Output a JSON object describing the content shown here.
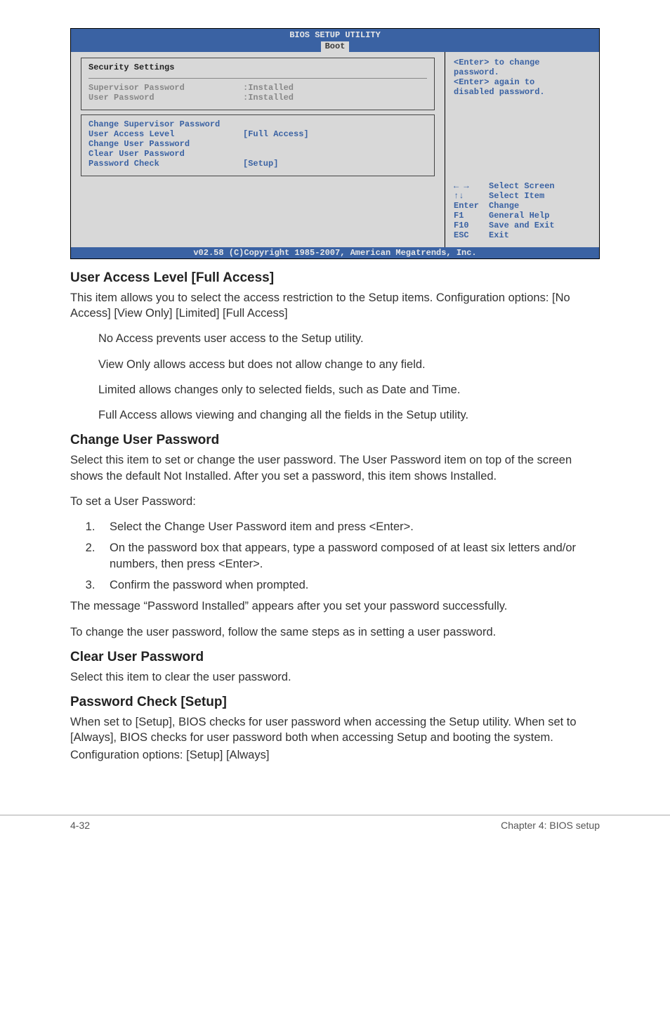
{
  "bios": {
    "title": "BIOS SETUP UTILITY",
    "tab": "Boot",
    "section_title": "Security Settings",
    "rows_grey": [
      {
        "label": "Supervisor Password",
        "value": ":Installed"
      },
      {
        "label": "User Password",
        "value": ":Installed"
      }
    ],
    "rows_blue": [
      {
        "label": "Change Supervisor Password",
        "value": ""
      },
      {
        "label": "User Access Level",
        "value": "[Full Access]"
      },
      {
        "label": "Change User Password",
        "value": ""
      },
      {
        "label": "Clear User Password",
        "value": ""
      },
      {
        "label": "Password Check",
        "value": "[Setup]"
      }
    ],
    "help": {
      "line1": "<Enter> to change",
      "line2": "password.",
      "line3": "<Enter> again to",
      "line4": "disabled password."
    },
    "nav": [
      {
        "key": "← →",
        "label": "Select Screen"
      },
      {
        "key": "↑↓",
        "label": "Select Item"
      },
      {
        "key": "Enter",
        "label": "Change"
      },
      {
        "key": "F1",
        "label": "General Help"
      },
      {
        "key": "F10",
        "label": "Save and Exit"
      },
      {
        "key": "ESC",
        "label": "Exit"
      }
    ],
    "footer": "v02.58 (C)Copyright 1985-2007, American Megatrends, Inc."
  },
  "sections": {
    "ual_head": "User Access Level [Full Access]",
    "ual_p1": "This item allows you to select the access restriction to the Setup items. Configuration options: [No Access] [View Only] [Limited] [Full Access]",
    "ual_noaccess": "No Access prevents user access to the Setup utility.",
    "ual_viewonly": "View Only allows access but does not allow change to any field.",
    "ual_limited": "Limited allows changes only to selected fields, such as Date and Time.",
    "ual_full": "Full Access allows viewing and changing all the fields in the Setup utility.",
    "cup_head": "Change User Password",
    "cup_p1": "Select this item to set or change the user password. The User Password item on top of the screen shows the default Not Installed. After you set a password, this item shows Installed.",
    "cup_p2": "To set a User Password:",
    "cup_li1": "Select the Change User Password item and press <Enter>.",
    "cup_li2": "On the password box that appears, type a password composed of at least six letters and/or numbers, then press <Enter>.",
    "cup_li3": "Confirm the password when prompted.",
    "cup_p3": "The message “Password Installed” appears after you set your password successfully.",
    "cup_p4": "To change the user password, follow the same steps as in setting a user password.",
    "clr_head": "Clear User Password",
    "clr_p1": "Select this item to clear the user password.",
    "pwc_head": "Password Check [Setup]",
    "pwc_p1": "When set to [Setup], BIOS checks for user password when accessing the Setup utility. When set to [Always], BIOS checks for user password both when accessing Setup and booting the system.",
    "pwc_p2": "Configuration options: [Setup] [Always]"
  },
  "footer": {
    "left": "4-32",
    "right": "Chapter 4: BIOS setup"
  }
}
